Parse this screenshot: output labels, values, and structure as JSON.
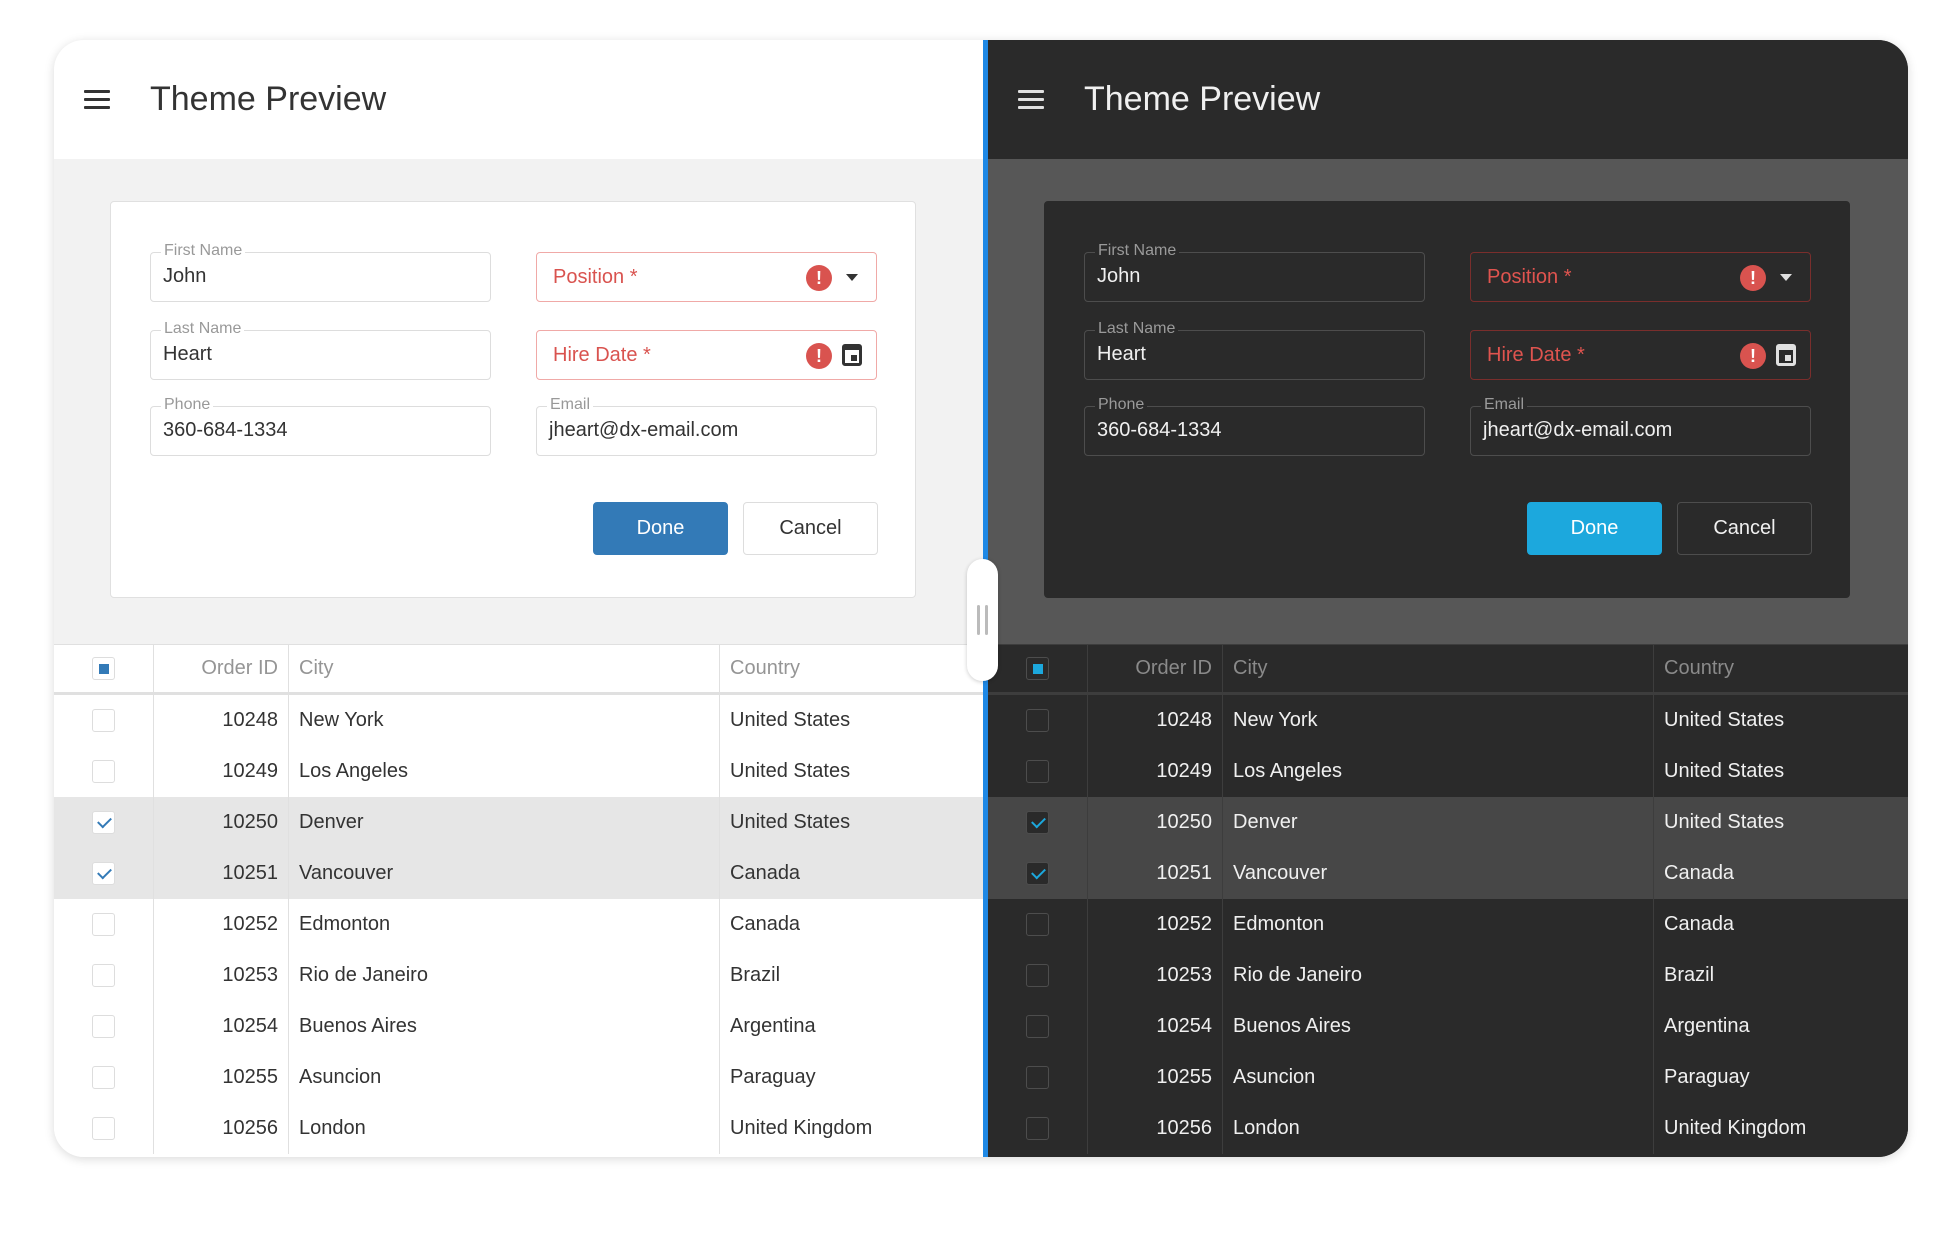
{
  "panels": [
    {
      "theme": "light",
      "title": "Theme Preview",
      "colors": {
        "header_bg": "#ffffff",
        "body_bg": "#f2f2f2",
        "form_bg": "#ffffff",
        "form_border": "#e0e0e0",
        "text": "#333333",
        "label": "#999999",
        "field_border": "#dddddd",
        "error": "#d9534f",
        "error_border": "#f0a9a7",
        "accent": "#337ab7",
        "done_text": "#ffffff",
        "cancel_bg": "#ffffff",
        "cancel_border": "#dddddd",
        "grid_bg": "#ffffff",
        "grid_line": "#e0e0e0",
        "header_text": "#959595",
        "selected_bg": "#e6e6e6",
        "cb_border": "#dddddd",
        "cb_bg": "#ffffff",
        "icon": "#333333"
      }
    },
    {
      "theme": "dark",
      "title": "Theme Preview",
      "colors": {
        "header_bg": "#2a2a2a",
        "body_bg": "#575757",
        "form_bg": "#2a2a2a",
        "form_border": "#2a2a2a",
        "text": "#f0f0f0",
        "label": "#9a9a9a",
        "field_border": "#4d4d4d",
        "error": "#e0544f",
        "error_border": "#7a2e2c",
        "accent": "#1ca8dd",
        "done_text": "#ffffff",
        "cancel_bg": "#2a2a2a",
        "cancel_border": "#4d4d4d",
        "grid_bg": "#2a2a2a",
        "grid_line": "#3d3d3d",
        "header_text": "#8a8a8a",
        "selected_bg": "#474747",
        "cb_border": "#4d4d4d",
        "cb_bg": "#2a2a2a",
        "icon": "#e0e0e0"
      }
    }
  ],
  "form": {
    "first_name": {
      "label": "First Name",
      "value": "John"
    },
    "last_name": {
      "label": "Last Name",
      "value": "Heart"
    },
    "phone": {
      "label": "Phone",
      "value": "360-684-1334"
    },
    "email": {
      "label": "Email",
      "value": "jheart@dx-email.com"
    },
    "position": {
      "placeholder": "Position *",
      "error_icon": "!"
    },
    "hire_date": {
      "placeholder": "Hire Date *",
      "error_icon": "!"
    },
    "done_label": "Done",
    "cancel_label": "Cancel"
  },
  "grid": {
    "columns": [
      "Order ID",
      "City",
      "Country"
    ],
    "rows": [
      {
        "id": "10248",
        "city": "New York",
        "country": "United States",
        "selected": false
      },
      {
        "id": "10249",
        "city": "Los Angeles",
        "country": "United States",
        "selected": false
      },
      {
        "id": "10250",
        "city": "Denver",
        "country": "United States",
        "selected": true
      },
      {
        "id": "10251",
        "city": "Vancouver",
        "country": "Canada",
        "selected": true
      },
      {
        "id": "10252",
        "city": "Edmonton",
        "country": "Canada",
        "selected": false
      },
      {
        "id": "10253",
        "city": "Rio de Janeiro",
        "country": "Brazil",
        "selected": false
      },
      {
        "id": "10254",
        "city": "Buenos Aires",
        "country": "Argentina",
        "selected": false
      },
      {
        "id": "10255",
        "city": "Asuncion",
        "country": "Paraguay",
        "selected": false
      },
      {
        "id": "10256",
        "city": "London",
        "country": "United Kingdom",
        "selected": false
      }
    ]
  },
  "divider_color": "#1e88e5"
}
